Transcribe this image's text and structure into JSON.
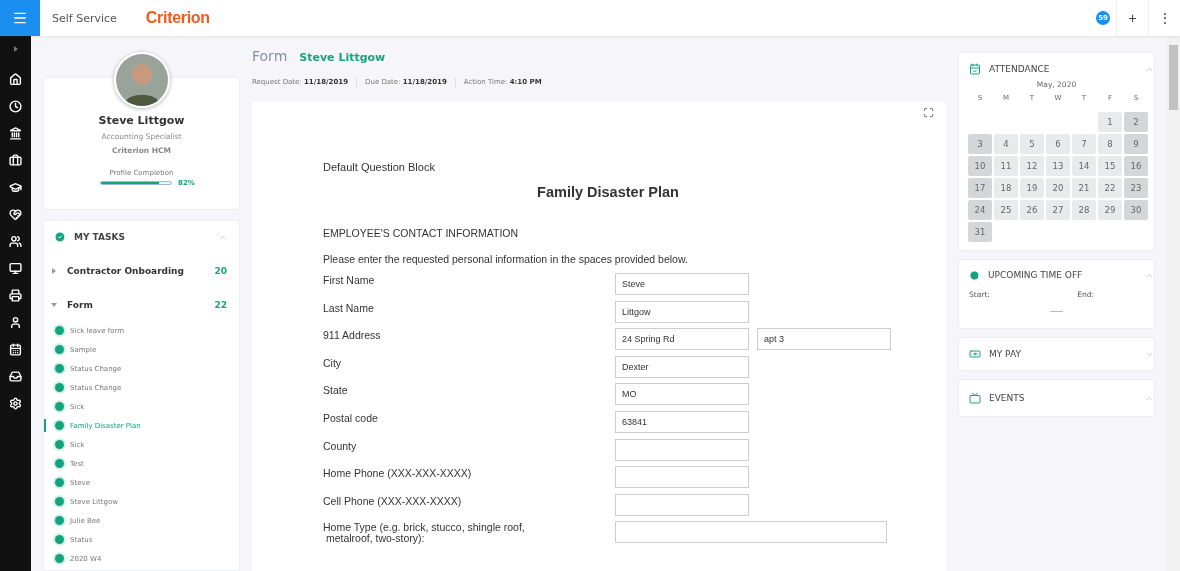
{
  "topbar": {
    "section": "Self Service",
    "brand": "Criterion",
    "notifications": "59",
    "add_label": "+",
    "more_label": "⋮"
  },
  "profile": {
    "name": "Steve Littgow",
    "title": "Accounting Specialist",
    "company": "Criterion HCM",
    "completion_label": "Profile Completion",
    "level": 0.82,
    "completion": "82%"
  },
  "tasks": {
    "title": "MY TASKS",
    "groups": [
      {
        "label": "Contractor Onboarding",
        "count": "20",
        "expanded": false
      },
      {
        "label": "Form",
        "count": "22",
        "expanded": true,
        "children": [
          {
            "label": "Sick leave form",
            "selected": false
          },
          {
            "label": "Sample",
            "selected": false
          },
          {
            "label": "Status Change",
            "selected": false
          },
          {
            "label": "Status Change",
            "selected": false
          },
          {
            "label": "Sick",
            "selected": false
          },
          {
            "label": "Family Disaster Plan",
            "selected": true
          },
          {
            "label": "Sick",
            "selected": false
          },
          {
            "label": "Test",
            "selected": false
          },
          {
            "label": "Steve",
            "selected": false
          },
          {
            "label": "Steve Littgow",
            "selected": false
          },
          {
            "label": "Julie Bee",
            "selected": false
          },
          {
            "label": "Status",
            "selected": false
          },
          {
            "label": "2020 W4",
            "selected": false
          }
        ]
      }
    ]
  },
  "form_header": {
    "kind_label": "Form",
    "person": "Steve Littgow",
    "meta": [
      {
        "label": "Request Date:",
        "value": "11/18/2019"
      },
      {
        "label": "Due Date:",
        "value": "11/18/2019"
      },
      {
        "label": "Action Time:",
        "value": "4:10 PM"
      }
    ]
  },
  "form": {
    "block": "Default Question Block",
    "title": "Family Disaster Plan",
    "section": "EMPLOYEE'S CONTACT INFORMATION",
    "instructions": "Please enter the requested personal information in the spaces provided below.",
    "fields": [
      {
        "label": "First Name",
        "values": [
          "Steve"
        ],
        "kind": "short"
      },
      {
        "label": "Last Name",
        "values": [
          "Littgow"
        ],
        "kind": "short"
      },
      {
        "label": "911 Address",
        "values": [
          "24 Spring Rd",
          "apt 3"
        ],
        "kind": "pair"
      },
      {
        "label": "City",
        "values": [
          "Dexter"
        ],
        "kind": "short"
      },
      {
        "label": "State",
        "values": [
          "MO"
        ],
        "kind": "short"
      },
      {
        "label": "Postal code",
        "values": [
          "63841"
        ],
        "kind": "short"
      },
      {
        "label": "County",
        "kind": "short"
      },
      {
        "label": "Home Phone (XXX-XXX-XXXX)",
        "kind": "short"
      },
      {
        "label": "Cell Phone (XXX-XXX-XXXX)",
        "kind": "short"
      },
      {
        "label": "Home Type (e.g. brick, stucco, shingle roof,\n metalroof, two-story):",
        "kind": "long"
      }
    ]
  },
  "attendance": {
    "title": "ATTENDANCE",
    "expanded": true,
    "month": "May, 2020",
    "weekdays": [
      "S",
      "M",
      "T",
      "W",
      "T",
      "F",
      "S"
    ],
    "days": [
      {
        "d": "1",
        "weekend": false
      },
      {
        "d": "2",
        "weekend": true
      },
      {
        "d": "3",
        "weekend": true
      },
      {
        "d": "4",
        "weekend": false
      },
      {
        "d": "5",
        "weekend": false
      },
      {
        "d": "6",
        "weekend": false
      },
      {
        "d": "7",
        "weekend": false
      },
      {
        "d": "8",
        "weekend": false
      },
      {
        "d": "9",
        "weekend": true
      },
      {
        "d": "10",
        "weekend": true
      },
      {
        "d": "11",
        "weekend": false
      },
      {
        "d": "12",
        "weekend": false
      },
      {
        "d": "13",
        "weekend": false
      },
      {
        "d": "14",
        "weekend": false
      },
      {
        "d": "15",
        "weekend": false
      },
      {
        "d": "16",
        "weekend": true
      },
      {
        "d": "17",
        "weekend": true
      },
      {
        "d": "18",
        "weekend": false
      },
      {
        "d": "19",
        "weekend": false
      },
      {
        "d": "20",
        "weekend": false
      },
      {
        "d": "21",
        "weekend": false
      },
      {
        "d": "22",
        "weekend": false
      },
      {
        "d": "23",
        "weekend": true
      },
      {
        "d": "24",
        "weekend": true
      },
      {
        "d": "25",
        "weekend": false
      },
      {
        "d": "26",
        "weekend": false
      },
      {
        "d": "27",
        "weekend": false
      },
      {
        "d": "28",
        "weekend": false
      },
      {
        "d": "29",
        "weekend": false
      },
      {
        "d": "30",
        "weekend": true
      },
      {
        "d": "31",
        "weekend": true
      }
    ]
  },
  "time_off": {
    "title": "UPCOMING TIME OFF",
    "expanded": true,
    "start_label": "Start:",
    "end_label": "End:"
  },
  "my_pay": {
    "title": "MY PAY",
    "expanded": false
  },
  "events": {
    "title": "EVENTS",
    "expanded": true
  }
}
